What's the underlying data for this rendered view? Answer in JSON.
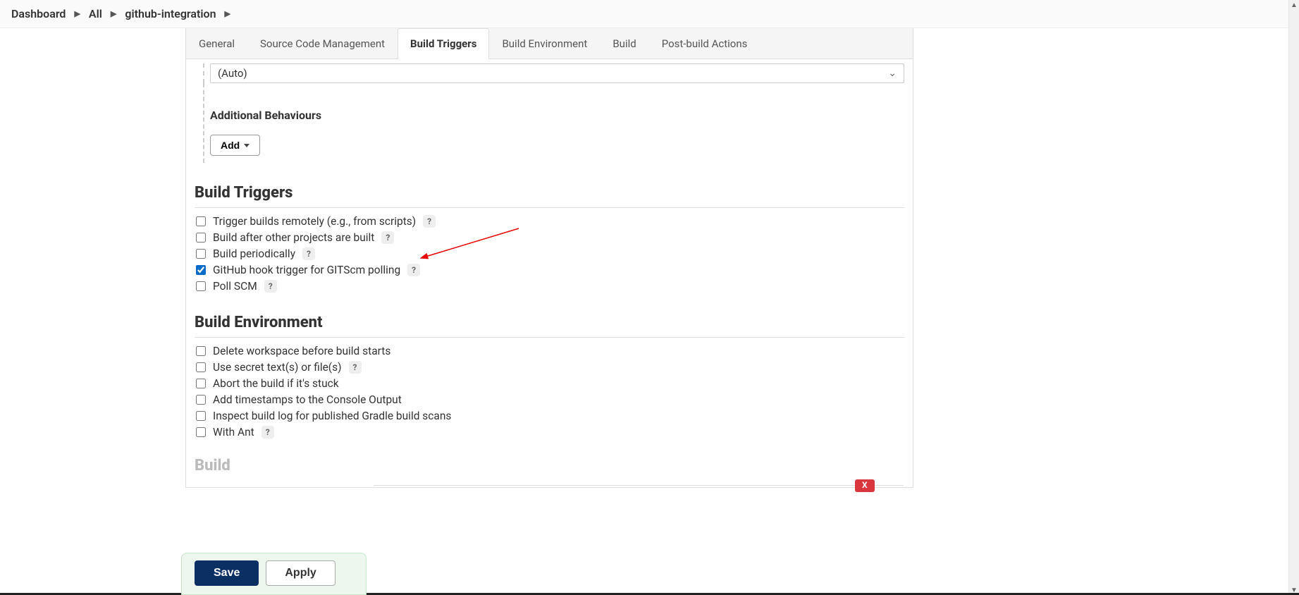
{
  "breadcrumb": {
    "dashboard": "Dashboard",
    "all": "All",
    "job": "github-integration"
  },
  "tabs": {
    "general": "General",
    "scm": "Source Code Management",
    "triggers": "Build Triggers",
    "env": "Build Environment",
    "build": "Build",
    "post": "Post-build Actions"
  },
  "browser_select": {
    "value": "(Auto)"
  },
  "behaviours": {
    "title": "Additional Behaviours",
    "add": "Add"
  },
  "sections": {
    "triggers": {
      "title": "Build Triggers",
      "opts": [
        {
          "label": "Trigger builds remotely (e.g., from scripts)",
          "checked": false,
          "help": true
        },
        {
          "label": "Build after other projects are built",
          "checked": false,
          "help": true
        },
        {
          "label": "Build periodically",
          "checked": false,
          "help": true
        },
        {
          "label": "GitHub hook trigger for GITScm polling",
          "checked": true,
          "help": true
        },
        {
          "label": "Poll SCM",
          "checked": false,
          "help": true
        }
      ]
    },
    "env": {
      "title": "Build Environment",
      "opts": [
        {
          "label": "Delete workspace before build starts",
          "checked": false,
          "help": false
        },
        {
          "label": "Use secret text(s) or file(s)",
          "checked": false,
          "help": true
        },
        {
          "label": "Abort the build if it's stuck",
          "checked": false,
          "help": false
        },
        {
          "label": "Add timestamps to the Console Output",
          "checked": false,
          "help": false
        },
        {
          "label": "Inspect build log for published Gradle build scans",
          "checked": false,
          "help": false
        },
        {
          "label": "With Ant",
          "checked": false,
          "help": true
        }
      ]
    },
    "build": {
      "title": "Build"
    }
  },
  "actions": {
    "save": "Save",
    "apply": "Apply"
  },
  "close_x": "X",
  "help_glyph": "?"
}
